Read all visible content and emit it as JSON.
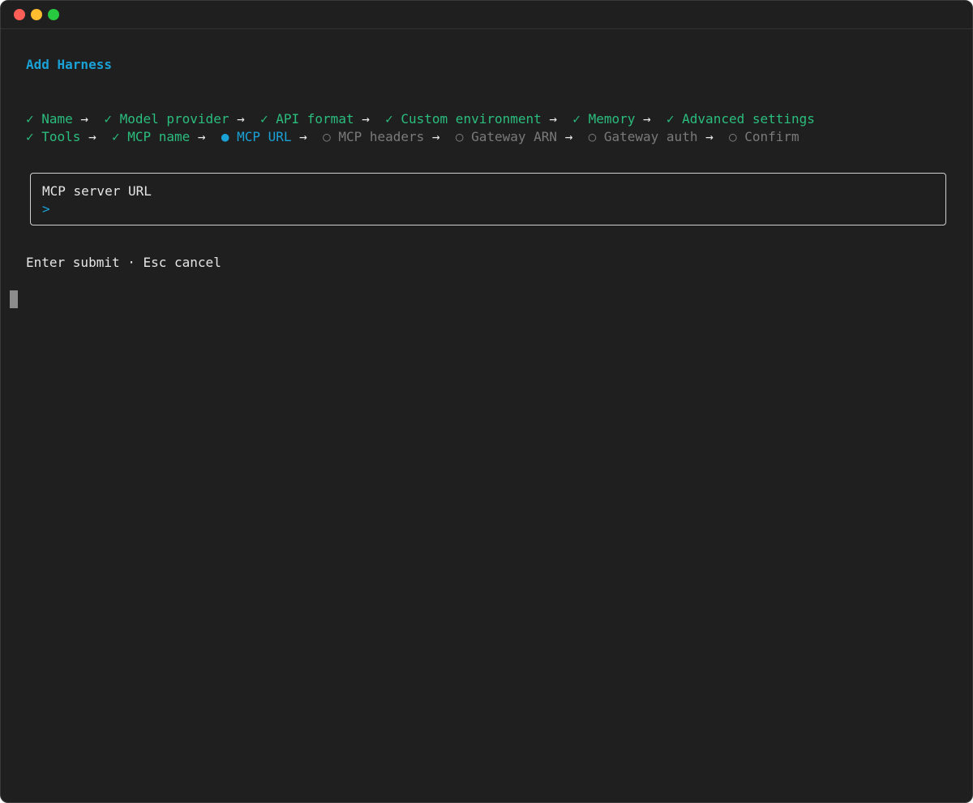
{
  "window": {
    "controls": [
      "close",
      "minimize",
      "maximize"
    ]
  },
  "title": "Add Harness",
  "steps": {
    "row1": [
      {
        "mark": "✓",
        "label": "Name",
        "status": "done"
      },
      {
        "mark": "✓",
        "label": "Model provider",
        "status": "done"
      },
      {
        "mark": "✓",
        "label": "API format",
        "status": "done"
      },
      {
        "mark": "✓",
        "label": "Custom environment",
        "status": "done"
      },
      {
        "mark": "✓",
        "label": "Memory",
        "status": "done"
      },
      {
        "mark": "✓",
        "label": "Advanced settings",
        "status": "done"
      }
    ],
    "row2": [
      {
        "mark": "✓",
        "label": "Tools",
        "status": "done"
      },
      {
        "mark": "✓",
        "label": "MCP name",
        "status": "done"
      },
      {
        "mark": "●",
        "label": "MCP URL",
        "status": "active"
      },
      {
        "mark": "○",
        "label": "MCP headers",
        "status": "pending"
      },
      {
        "mark": "○",
        "label": "Gateway ARN",
        "status": "pending"
      },
      {
        "mark": "○",
        "label": "Gateway auth",
        "status": "pending"
      },
      {
        "mark": "○",
        "label": "Confirm",
        "status": "pending"
      }
    ],
    "separator": "→"
  },
  "input": {
    "label": "MCP server URL",
    "prompt": ">",
    "value": ""
  },
  "hint": "Enter submit · Esc cancel",
  "colors": {
    "background": "#1f1f1f",
    "accent": "#1aa1d6",
    "done": "#2bbd7e",
    "pending": "#7a7a7a",
    "text": "#e6e6e6"
  }
}
